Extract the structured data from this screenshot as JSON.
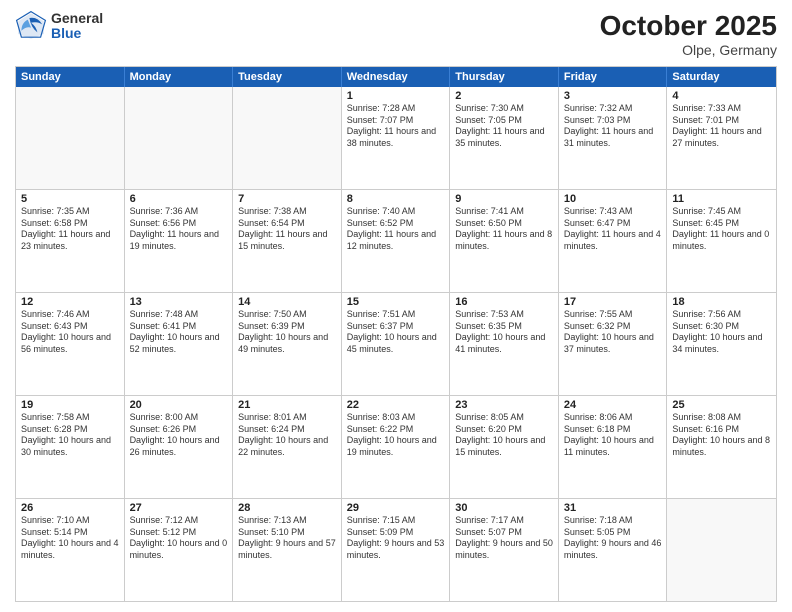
{
  "logo": {
    "general": "General",
    "blue": "Blue"
  },
  "title": "October 2025",
  "location": "Olpe, Germany",
  "days": [
    "Sunday",
    "Monday",
    "Tuesday",
    "Wednesday",
    "Thursday",
    "Friday",
    "Saturday"
  ],
  "rows": [
    [
      {
        "day": "",
        "text": ""
      },
      {
        "day": "",
        "text": ""
      },
      {
        "day": "",
        "text": ""
      },
      {
        "day": "1",
        "text": "Sunrise: 7:28 AM\nSunset: 7:07 PM\nDaylight: 11 hours and 38 minutes."
      },
      {
        "day": "2",
        "text": "Sunrise: 7:30 AM\nSunset: 7:05 PM\nDaylight: 11 hours and 35 minutes."
      },
      {
        "day": "3",
        "text": "Sunrise: 7:32 AM\nSunset: 7:03 PM\nDaylight: 11 hours and 31 minutes."
      },
      {
        "day": "4",
        "text": "Sunrise: 7:33 AM\nSunset: 7:01 PM\nDaylight: 11 hours and 27 minutes."
      }
    ],
    [
      {
        "day": "5",
        "text": "Sunrise: 7:35 AM\nSunset: 6:58 PM\nDaylight: 11 hours and 23 minutes."
      },
      {
        "day": "6",
        "text": "Sunrise: 7:36 AM\nSunset: 6:56 PM\nDaylight: 11 hours and 19 minutes."
      },
      {
        "day": "7",
        "text": "Sunrise: 7:38 AM\nSunset: 6:54 PM\nDaylight: 11 hours and 15 minutes."
      },
      {
        "day": "8",
        "text": "Sunrise: 7:40 AM\nSunset: 6:52 PM\nDaylight: 11 hours and 12 minutes."
      },
      {
        "day": "9",
        "text": "Sunrise: 7:41 AM\nSunset: 6:50 PM\nDaylight: 11 hours and 8 minutes."
      },
      {
        "day": "10",
        "text": "Sunrise: 7:43 AM\nSunset: 6:47 PM\nDaylight: 11 hours and 4 minutes."
      },
      {
        "day": "11",
        "text": "Sunrise: 7:45 AM\nSunset: 6:45 PM\nDaylight: 11 hours and 0 minutes."
      }
    ],
    [
      {
        "day": "12",
        "text": "Sunrise: 7:46 AM\nSunset: 6:43 PM\nDaylight: 10 hours and 56 minutes."
      },
      {
        "day": "13",
        "text": "Sunrise: 7:48 AM\nSunset: 6:41 PM\nDaylight: 10 hours and 52 minutes."
      },
      {
        "day": "14",
        "text": "Sunrise: 7:50 AM\nSunset: 6:39 PM\nDaylight: 10 hours and 49 minutes."
      },
      {
        "day": "15",
        "text": "Sunrise: 7:51 AM\nSunset: 6:37 PM\nDaylight: 10 hours and 45 minutes."
      },
      {
        "day": "16",
        "text": "Sunrise: 7:53 AM\nSunset: 6:35 PM\nDaylight: 10 hours and 41 minutes."
      },
      {
        "day": "17",
        "text": "Sunrise: 7:55 AM\nSunset: 6:32 PM\nDaylight: 10 hours and 37 minutes."
      },
      {
        "day": "18",
        "text": "Sunrise: 7:56 AM\nSunset: 6:30 PM\nDaylight: 10 hours and 34 minutes."
      }
    ],
    [
      {
        "day": "19",
        "text": "Sunrise: 7:58 AM\nSunset: 6:28 PM\nDaylight: 10 hours and 30 minutes."
      },
      {
        "day": "20",
        "text": "Sunrise: 8:00 AM\nSunset: 6:26 PM\nDaylight: 10 hours and 26 minutes."
      },
      {
        "day": "21",
        "text": "Sunrise: 8:01 AM\nSunset: 6:24 PM\nDaylight: 10 hours and 22 minutes."
      },
      {
        "day": "22",
        "text": "Sunrise: 8:03 AM\nSunset: 6:22 PM\nDaylight: 10 hours and 19 minutes."
      },
      {
        "day": "23",
        "text": "Sunrise: 8:05 AM\nSunset: 6:20 PM\nDaylight: 10 hours and 15 minutes."
      },
      {
        "day": "24",
        "text": "Sunrise: 8:06 AM\nSunset: 6:18 PM\nDaylight: 10 hours and 11 minutes."
      },
      {
        "day": "25",
        "text": "Sunrise: 8:08 AM\nSunset: 6:16 PM\nDaylight: 10 hours and 8 minutes."
      }
    ],
    [
      {
        "day": "26",
        "text": "Sunrise: 7:10 AM\nSunset: 5:14 PM\nDaylight: 10 hours and 4 minutes."
      },
      {
        "day": "27",
        "text": "Sunrise: 7:12 AM\nSunset: 5:12 PM\nDaylight: 10 hours and 0 minutes."
      },
      {
        "day": "28",
        "text": "Sunrise: 7:13 AM\nSunset: 5:10 PM\nDaylight: 9 hours and 57 minutes."
      },
      {
        "day": "29",
        "text": "Sunrise: 7:15 AM\nSunset: 5:09 PM\nDaylight: 9 hours and 53 minutes."
      },
      {
        "day": "30",
        "text": "Sunrise: 7:17 AM\nSunset: 5:07 PM\nDaylight: 9 hours and 50 minutes."
      },
      {
        "day": "31",
        "text": "Sunrise: 7:18 AM\nSunset: 5:05 PM\nDaylight: 9 hours and 46 minutes."
      },
      {
        "day": "",
        "text": ""
      }
    ]
  ]
}
